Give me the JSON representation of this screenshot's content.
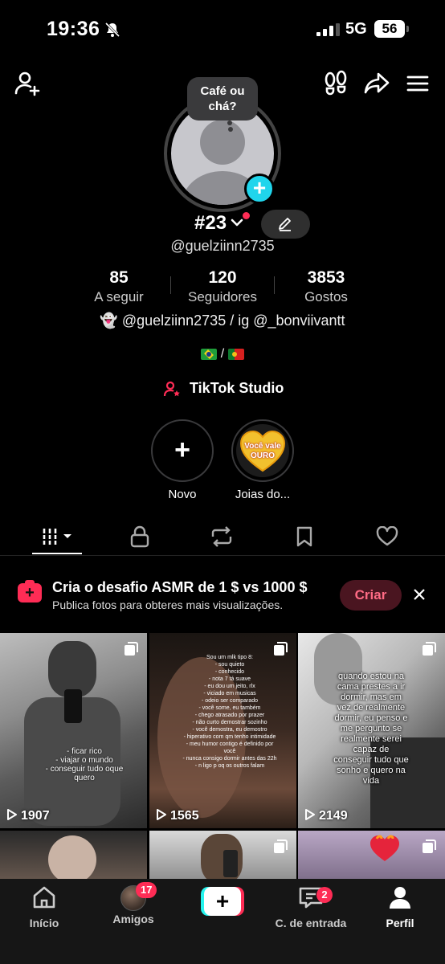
{
  "status_bar": {
    "time": "19:36",
    "network": "5G",
    "battery": "56"
  },
  "profile": {
    "bubble": "Café ou chá?",
    "name": "#23",
    "handle": "@guelziinn2735",
    "stats": [
      {
        "num": "85",
        "label": "A seguir"
      },
      {
        "num": "120",
        "label": "Seguidores"
      },
      {
        "num": "3853",
        "label": "Gostos"
      }
    ],
    "bio": "👻 @guelziinn2735 / ig @_bonviivantt",
    "flags_sep": "/",
    "studio": "TikTok Studio"
  },
  "highlights": [
    {
      "label": "Novo",
      "plus": "+"
    },
    {
      "label": "Joias do...",
      "heart_text": "Você vale OURO"
    }
  ],
  "banner": {
    "icon": "+",
    "title": "Cria o desafio ASMR de 1 $ vs 1000 $",
    "subtitle": "Publica fotos para obteres mais visualizações.",
    "button": "Criar"
  },
  "videos": [
    {
      "views": "1907",
      "text": "- ficar rico\n- viajar o mundo\n- conseguir tudo oque quero"
    },
    {
      "views": "1565",
      "text": "Sou um mlk tipo 8:\n- sou quieto\n- conhecido\n- nota 7 tá suave\n- eu dou um jeito, rlx\n- viciado em musicas\n- odeio ser comparado\n- você some, eu também\n- chego atrasado por prazer\n- não curto demostrar sozinho\n- você demostra, eu demostro\n- hiperativo com qm tenho intimidade\n- meu humor contigo é definido por você\n- nunca consigo dormir antes das 22h\n- n ligo p oq os outros falam"
    },
    {
      "views": "2149",
      "text": "quando estou na cama prestes a ir dormir, mas em vez de realmente dormir, eu penso e me pergunto se realmente serei capaz de conseguir tudo que sonho e quero na vida"
    }
  ],
  "nav": {
    "home": "Início",
    "friends": "Amigos",
    "friends_badge": "17",
    "create": "+",
    "inbox": "C. de entrada",
    "inbox_badge": "2",
    "profile": "Perfil"
  }
}
